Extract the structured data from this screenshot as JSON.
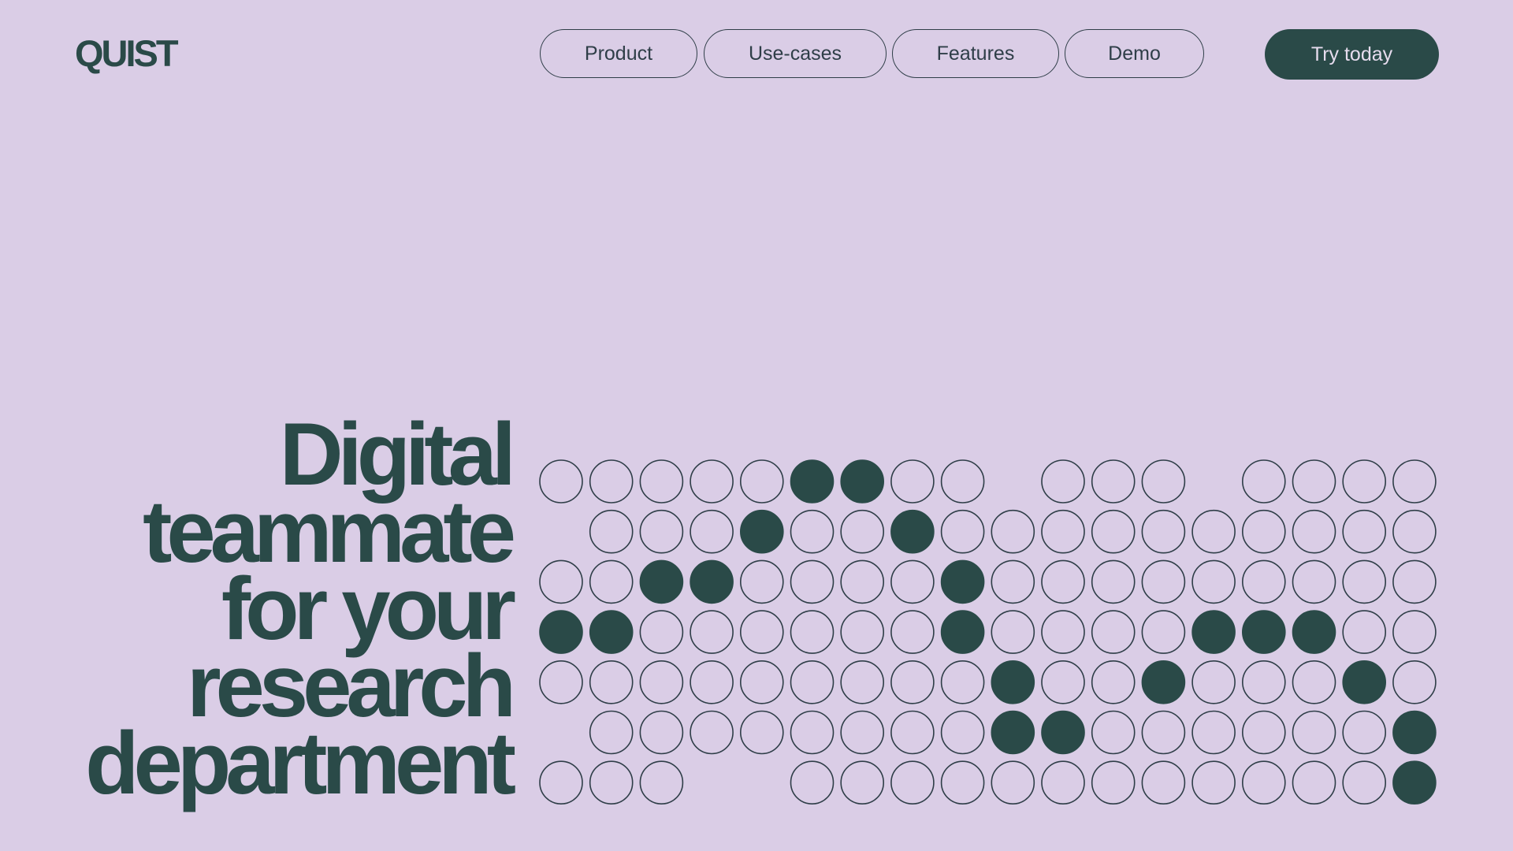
{
  "brand": {
    "logo_text": "QUIST"
  },
  "nav": {
    "items": [
      {
        "label": "Product"
      },
      {
        "label": "Use-cases"
      },
      {
        "label": "Features"
      },
      {
        "label": "Demo"
      }
    ],
    "cta_label": "Try today"
  },
  "hero": {
    "headline_lines": [
      "Digital",
      "teammate",
      "for your",
      "research",
      "department"
    ]
  },
  "dot_grid": {
    "legend": {
      ".": "empty",
      "o": "outlined",
      "#": "filled"
    },
    "rows": [
      "ooooo##oo.ooo.oooo",
      ".ooo#oo#oooooooooo.",
      "oo##oooo#ooooooooo",
      "##oooooo#oooo###oo",
      "ooooooooo#oo#ooo#o",
      ".oooooooo##oooooo#",
      "ooo..oooooooooooo#"
    ]
  },
  "colors": {
    "background": "#dacde6",
    "ink": "#2a4a48",
    "outline": "#2f3e48"
  }
}
